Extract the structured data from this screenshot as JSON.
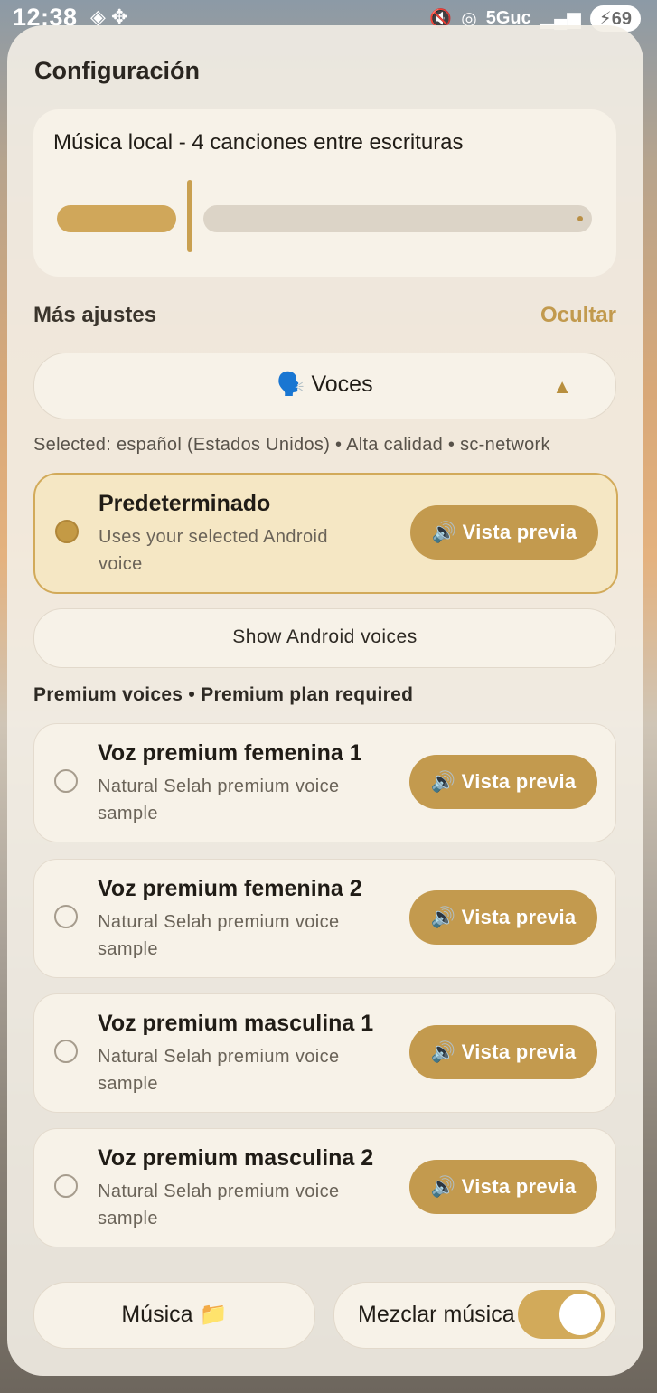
{
  "status_bar": {
    "time": "12:38",
    "network": "5Guc",
    "battery": "69"
  },
  "title": "Configuración",
  "music_card": {
    "title": "Música local - 4 canciones entre escrituras",
    "slider_fraction": 0.22
  },
  "more_settings": {
    "label": "Más ajustes",
    "hide_label": "Ocultar"
  },
  "voices_section": {
    "label": "🗣️ Voces",
    "arrow": "▲"
  },
  "selected_text": "Selected: español (Estados Unidos) • Alta calidad • sc-network",
  "default_voice": {
    "name": "Predeterminado",
    "description": "Uses your selected Android voice",
    "preview_label": "🔊 Vista previa",
    "selected": true
  },
  "android_voices_button": "Show Android voices",
  "premium_header": "Premium voices • Premium plan required",
  "premium_voices": [
    {
      "name": "Voz premium femenina 1",
      "description": "Natural Selah premium voice sample",
      "preview_label": "🔊 Vista previa",
      "selected": false
    },
    {
      "name": "Voz premium femenina 2",
      "description": "Natural Selah premium voice sample",
      "preview_label": "🔊 Vista previa",
      "selected": false
    },
    {
      "name": "Voz premium masculina 1",
      "description": "Natural Selah premium voice sample",
      "preview_label": "🔊 Vista previa",
      "selected": false
    },
    {
      "name": "Voz premium masculina 2",
      "description": "Natural Selah premium voice sample",
      "preview_label": "🔊 Vista previa",
      "selected": false
    }
  ],
  "bottom": {
    "music_button": "Música 📁",
    "mix_label": "Mezclar música",
    "mix_enabled": true
  },
  "colors": {
    "accent": "#c39a4e",
    "card": "#f7f2e8",
    "selected_card": "#f5e7c4"
  }
}
